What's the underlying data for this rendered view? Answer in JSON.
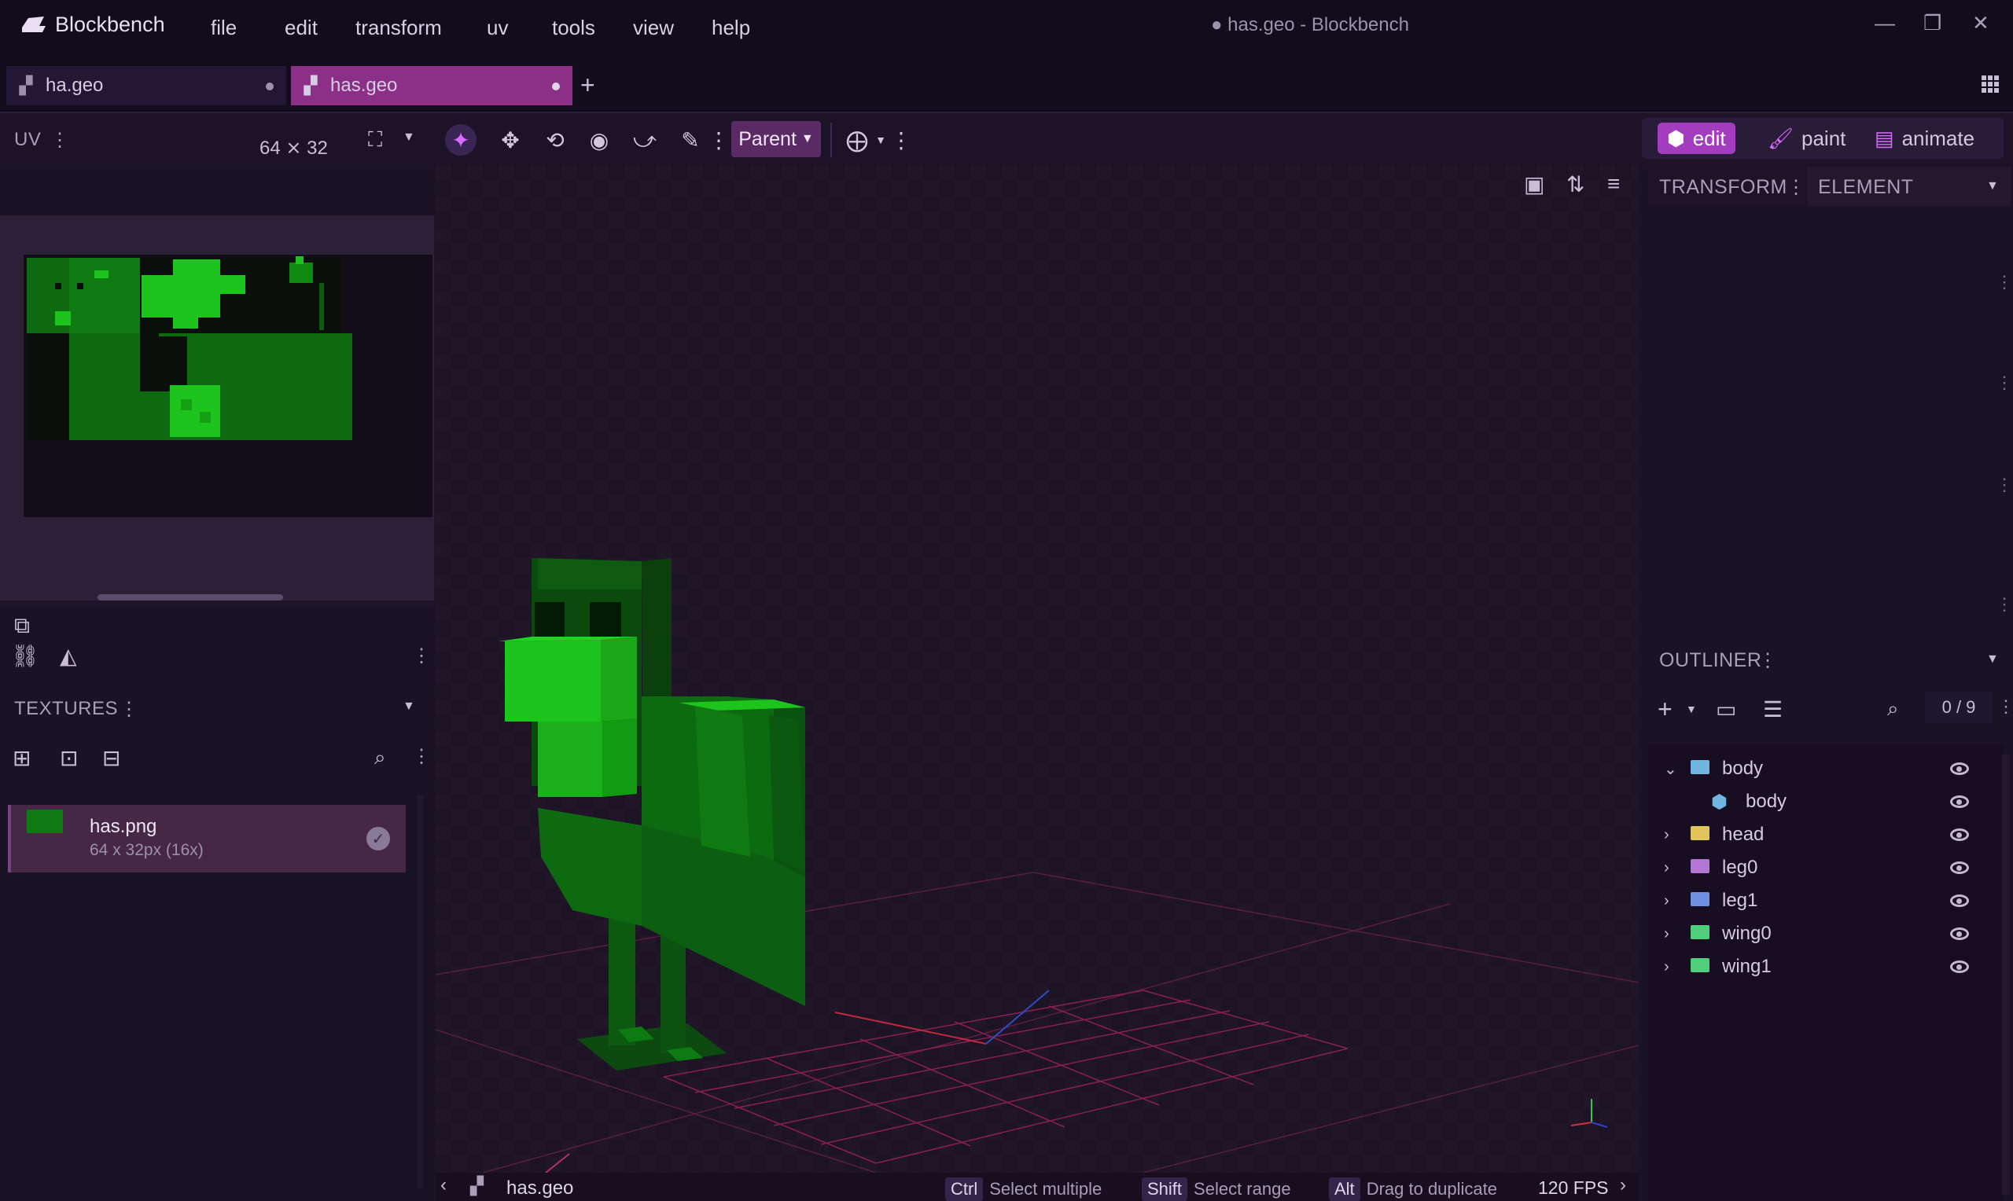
{
  "app": {
    "name": "Blockbench",
    "window_title": "● has.geo - Blockbench"
  },
  "menu": [
    "file",
    "edit",
    "transform",
    "uv",
    "tools",
    "view",
    "help"
  ],
  "tabs": [
    {
      "label": "ha.geo",
      "active": false
    },
    {
      "label": "has.geo",
      "active": true
    }
  ],
  "toolbar": {
    "pivot_mode": "Parent"
  },
  "modes": [
    {
      "label": "edit",
      "active": true
    },
    {
      "label": "paint",
      "active": false
    },
    {
      "label": "animate",
      "active": false
    }
  ],
  "uv_panel": {
    "title": "UV",
    "size": "64 ⨯ 32"
  },
  "textures_panel": {
    "title": "TEXTURES",
    "items": [
      {
        "name": "has.png",
        "info": "64 x 32px (16x)"
      }
    ]
  },
  "right_panel": {
    "tabs": [
      "TRANSFORM",
      "ELEMENT"
    ],
    "outliner_title": "OUTLINER",
    "counter": "0 / 9",
    "items": [
      {
        "label": "body",
        "type": "group",
        "expanded": true,
        "color": "#6fb6e0",
        "indent": 0
      },
      {
        "label": "body",
        "type": "cube",
        "color": "#6fb6e0",
        "indent": 1
      },
      {
        "label": "head",
        "type": "group",
        "expanded": false,
        "color": "#e2c45c",
        "indent": 0
      },
      {
        "label": "leg0",
        "type": "group",
        "expanded": false,
        "color": "#b277d4",
        "indent": 0
      },
      {
        "label": "leg1",
        "type": "group",
        "expanded": false,
        "color": "#6f8fe0",
        "indent": 0
      },
      {
        "label": "wing0",
        "type": "group",
        "expanded": false,
        "color": "#4fcf7a",
        "indent": 0
      },
      {
        "label": "wing1",
        "type": "group",
        "expanded": false,
        "color": "#4fcf7a",
        "indent": 0
      }
    ]
  },
  "statusbar": {
    "file": "has.geo",
    "hints": [
      {
        "key": "Ctrl",
        "text": "Select multiple"
      },
      {
        "key": "Shift",
        "text": "Select range"
      },
      {
        "key": "Alt",
        "text": "Drag to duplicate"
      }
    ],
    "fps": "120 FPS"
  },
  "colors": {
    "accent": "#a43cc0",
    "background": "#1a1226",
    "model_green": "#0e7a10"
  }
}
